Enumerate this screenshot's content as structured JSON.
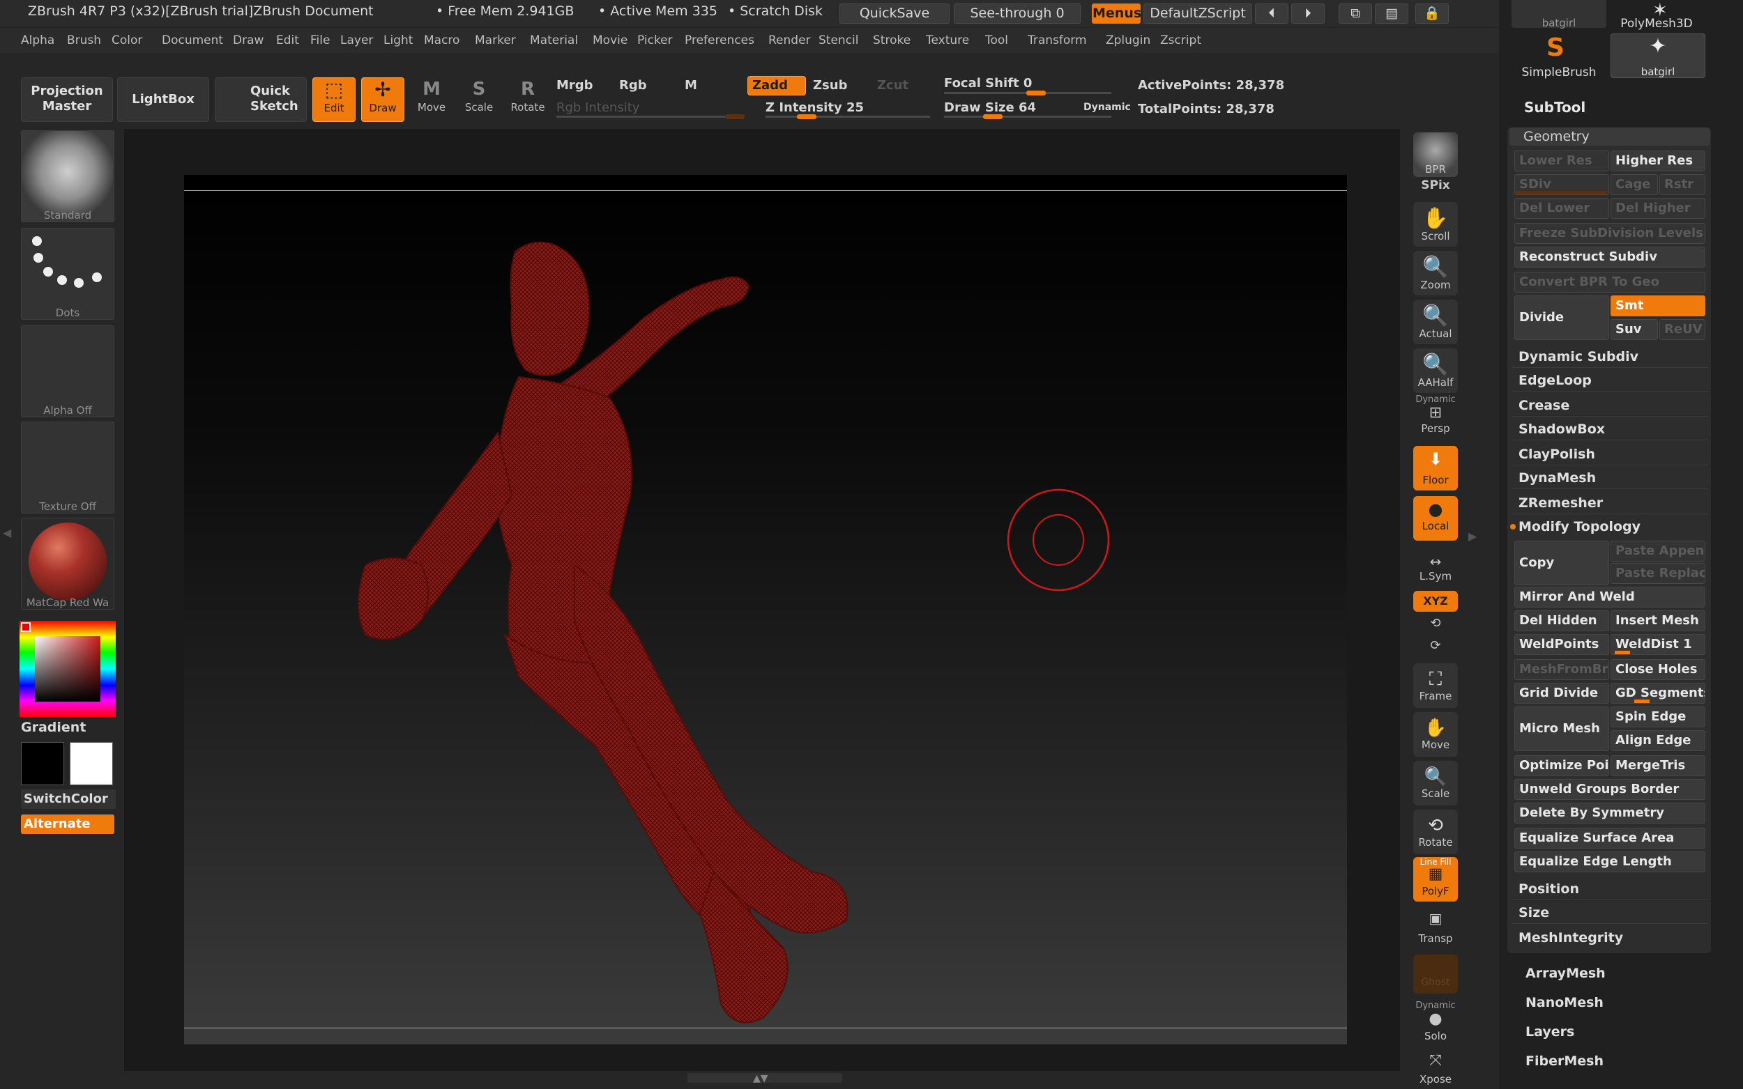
{
  "title_bar": {
    "app_title": "ZBrush 4R7 P3 (x32)[ZBrush trial]ZBrush Document",
    "free_mem": "• Free Mem 2.941GB",
    "active_mem": "• Active Mem 335",
    "scratch_disk": "• Scratch Disk",
    "quicksave": "QuickSave",
    "see_through": "See-through  0",
    "menus": "Menus",
    "default_zscript": "DefaultZScript"
  },
  "menu": [
    "Alpha",
    "Brush",
    "Color",
    "Document",
    "Draw",
    "Edit",
    "File",
    "Layer",
    "Light",
    "Macro",
    "Marker",
    "Material",
    "Movie",
    "Picker",
    "Preferences",
    "Render",
    "Stencil",
    "Stroke",
    "Texture",
    "Tool",
    "Transform",
    "Zplugin",
    "Zscript"
  ],
  "toolbar": {
    "projection_master": "Projection\nMaster",
    "lightbox": "LightBox",
    "quick_sketch": "Quick\nSketch",
    "edit": "Edit",
    "draw": "Draw",
    "move": "Move",
    "scale": "Scale",
    "rotate": "Rotate",
    "mrgb": "Mrgb",
    "rgb": "Rgb",
    "m": "M",
    "zadd": "Zadd",
    "zsub": "Zsub",
    "zcut": "Zcut",
    "rgb_intensity": "Rgb  Intensity",
    "z_intensity": "Z Intensity 25",
    "z_intensity_value": 25,
    "focal_shift": "Focal Shift 0",
    "draw_size": "Draw Size 64",
    "dynamic": "Dynamic",
    "active_points": "ActivePoints: 28,378",
    "total_points": "TotalPoints: 28,378"
  },
  "left_panel": {
    "brush": "Standard",
    "stroke": "Dots",
    "alpha": "Alpha  Off",
    "texture": "Texture  Off",
    "material": "MatCap  Red  Wa",
    "gradient": "Gradient",
    "switch_color": "SwitchColor",
    "alternate": "Alternate"
  },
  "right_shelf": [
    "BPR",
    "SPix",
    "Scroll",
    "Zoom",
    "Actual",
    "AAHalf",
    "Dynamic",
    "Persp",
    "Floor",
    "Local",
    "L.Sym",
    "XYZ",
    "Frame",
    "Move",
    "Scale",
    "Rotate",
    "Line Fill",
    "PolyF",
    "Transp",
    "Ghost",
    "Dynamic",
    "Solo",
    "Xpose"
  ],
  "tray": {
    "top_tools": [
      "batgirl",
      "PolyMesh3D",
      "SimpleBrush",
      "batgirl"
    ],
    "subtool": "SubTool",
    "geometry": "Geometry",
    "lower_res": "Lower Res",
    "higher_res": "Higher Res",
    "sdiv": "SDiv",
    "cage": "Cage",
    "rstr": "Rstr",
    "del_lower": "Del Lower",
    "del_higher": "Del Higher",
    "freeze": "Freeze SubDivision Levels",
    "reconstruct": "Reconstruct Subdiv",
    "convert_bpr": "Convert BPR To Geo",
    "divide": "Divide",
    "smt": "Smt",
    "suv": "Suv",
    "reuv": "ReUV",
    "dynamic_subdiv": "Dynamic Subdiv",
    "edgeloop": "EdgeLoop",
    "crease": "Crease",
    "shadowbox": "ShadowBox",
    "claypolish": "ClayPolish",
    "dynamesh": "DynaMesh",
    "zremesher": "ZRemesher",
    "modify_topology": "Modify Topology",
    "copy": "Copy",
    "paste_append": "Paste Appen",
    "paste_replace": "Paste Replac",
    "mirror_weld": "Mirror And Weld",
    "del_hidden": "Del Hidden",
    "insert_mesh": "Insert Mesh",
    "weldpoints": "WeldPoints",
    "welddist": "WeldDist 1",
    "meshfrombrush": "MeshFromBr",
    "close_holes": "Close Holes",
    "grid_divide": "Grid Divide",
    "gd_segments": "GD Segments",
    "micro_mesh": "Micro Mesh",
    "spin_edge": "Spin Edge",
    "align_edge": "Align Edge",
    "optimize_points": "Optimize Poi",
    "mergetris": "MergeTris",
    "unweld_groups": "Unweld Groups Border",
    "delete_symmetry": "Delete By Symmetry",
    "equalize_surface": "Equalize Surface Area",
    "equalize_edge": "Equalize Edge Length",
    "position": "Position",
    "size": "Size",
    "meshintegrity": "MeshIntegrity",
    "arraymesh": "ArrayMesh",
    "nanomesh": "NanoMesh",
    "layers": "Layers",
    "fibermesh": "FiberMesh"
  },
  "colors": {
    "accent": "#f07a0c",
    "mesh": "#8c1a16",
    "cursor": "#d01818"
  }
}
